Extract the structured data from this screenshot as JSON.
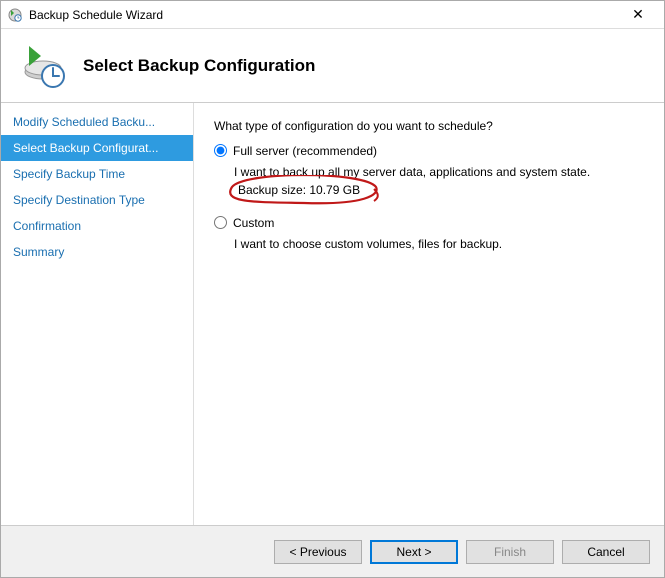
{
  "window": {
    "title": "Backup Schedule Wizard"
  },
  "header": {
    "title": "Select Backup Configuration"
  },
  "sidebar": {
    "steps": [
      "Modify Scheduled Backu...",
      "Select Backup Configurat...",
      "Specify Backup Time",
      "Specify Destination Type",
      "Confirmation",
      "Summary"
    ],
    "active_index": 1
  },
  "content": {
    "question": "What type of configuration do you want to schedule?",
    "option_full_label": "Full server (recommended)",
    "option_full_desc": "I want to back up all my server data, applications and system state.",
    "backup_size_line": "Backup size: 10.79 GB",
    "option_custom_label": "Custom",
    "option_custom_desc": "I want to choose custom volumes, files for backup."
  },
  "footer": {
    "previous": "< Previous",
    "next": "Next >",
    "finish": "Finish",
    "cancel": "Cancel"
  },
  "annotation_color": "#c01818"
}
